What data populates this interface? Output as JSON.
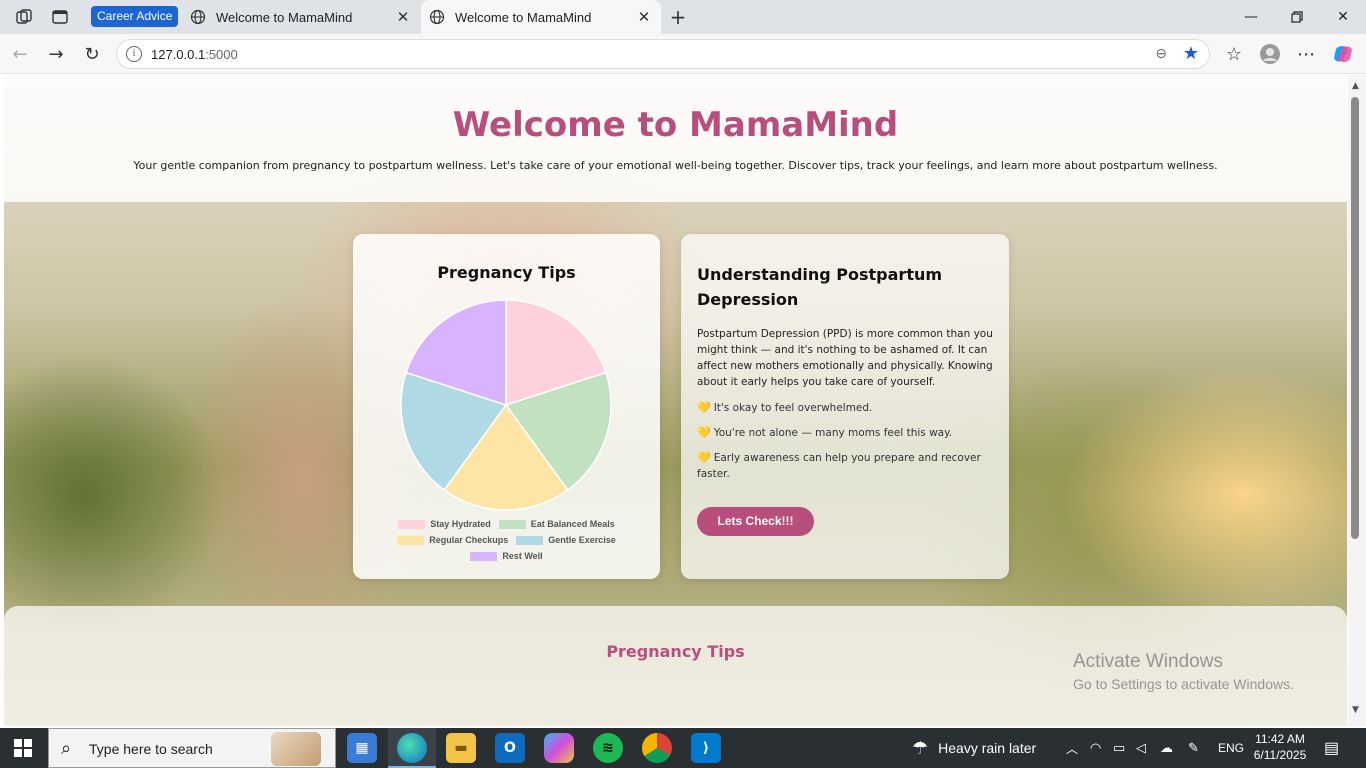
{
  "browser": {
    "tab_group_label": "Career Advice",
    "tabs": [
      {
        "title": "Welcome to MamaMind",
        "active": false
      },
      {
        "title": "Welcome to MamaMind",
        "active": true
      }
    ],
    "url_host": "127.0.0.1",
    "url_port": ":5000"
  },
  "page": {
    "title": "Welcome to MamaMind",
    "subtitle": "Your gentle companion from pregnancy to postpartum wellness. Let's take care of your emotional well-being together. Discover tips, track your feelings, and learn more about postpartum wellness.",
    "chart_card_title": "Pregnancy Tips",
    "ppd": {
      "title": "Understanding Postpartum Depression",
      "body": "Postpartum Depression (PPD) is more common than you might think — and it's nothing to be ashamed of. It can affect new mothers emotionally and physically. Knowing about it early helps you take care of yourself.",
      "points": [
        "It's okay to feel overwhelmed.",
        "You're not alone — many moms feel this way.",
        "Early awareness can help you prepare and recover faster."
      ],
      "button_label": "Lets Check!!!"
    },
    "tips_section_heading": "Pregnancy Tips"
  },
  "chart_data": {
    "type": "pie",
    "title": "Pregnancy Tips",
    "categories": [
      "Stay Hydrated",
      "Eat Balanced Meals",
      "Regular Checkups",
      "Gentle Exercise",
      "Rest Well"
    ],
    "values": [
      20,
      20,
      20,
      20,
      20
    ],
    "colors": [
      "#ffd1dc",
      "#c1e1c1",
      "#fce5a5",
      "#b0d9e6",
      "#d8b4fe"
    ],
    "legend_position": "bottom"
  },
  "watermark": {
    "line1": "Activate Windows",
    "line2": "Go to Settings to activate Windows."
  },
  "taskbar": {
    "search_placeholder": "Type here to search",
    "weather": "Heavy rain later",
    "language": "ENG",
    "time": "11:42 AM",
    "date": "6/11/2025"
  },
  "colors": {
    "brand": "#b84e7d",
    "tab_group": "#1d66d1",
    "bookmark_star": "#1a5fd0"
  }
}
